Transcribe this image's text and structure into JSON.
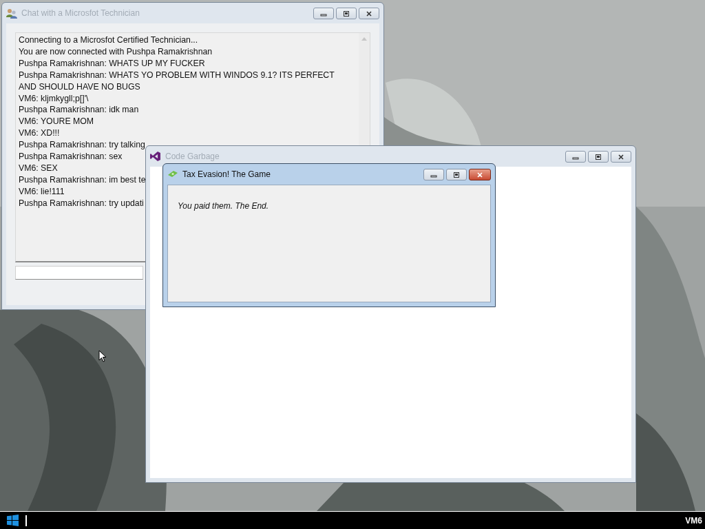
{
  "windows": [
    {
      "kind": "chat",
      "title": "Chat with a Microsfot Technician",
      "active": false,
      "lines": [
        "Connecting to a Microsfot Certified Technician...",
        "You are now connected with Pushpa Ramakrishnan",
        "Pushpa Ramakrishnan: WHATS UP MY FUCKER",
        "Pushpa Ramakrishnan: WHATS YO PROBLEM WITH WINDOS 9.1? ITS PERFECT AND SHOULD HAVE NO BUGS",
        "VM6: kljmkygll;p[]'\\",
        "Pushpa Ramakrishnan: idk man",
        "VM6: YOURE MOM",
        "VM6: XD!!!",
        "Pushpa Ramakrishnan: try talking",
        "Pushpa Ramakrishnan: sex",
        "VM6: SEX",
        "Pushpa Ramakrishnan: im best te",
        "VM6: lie!111",
        "Pushpa Ramakrishnan: try updati"
      ]
    },
    {
      "kind": "editor",
      "title": "Code Garbage",
      "active": false
    },
    {
      "kind": "dialog",
      "title": "Tax Evasion! The Game",
      "active": true,
      "message": "You paid them. The End."
    }
  ],
  "taskbar": {
    "label": "VM6"
  }
}
